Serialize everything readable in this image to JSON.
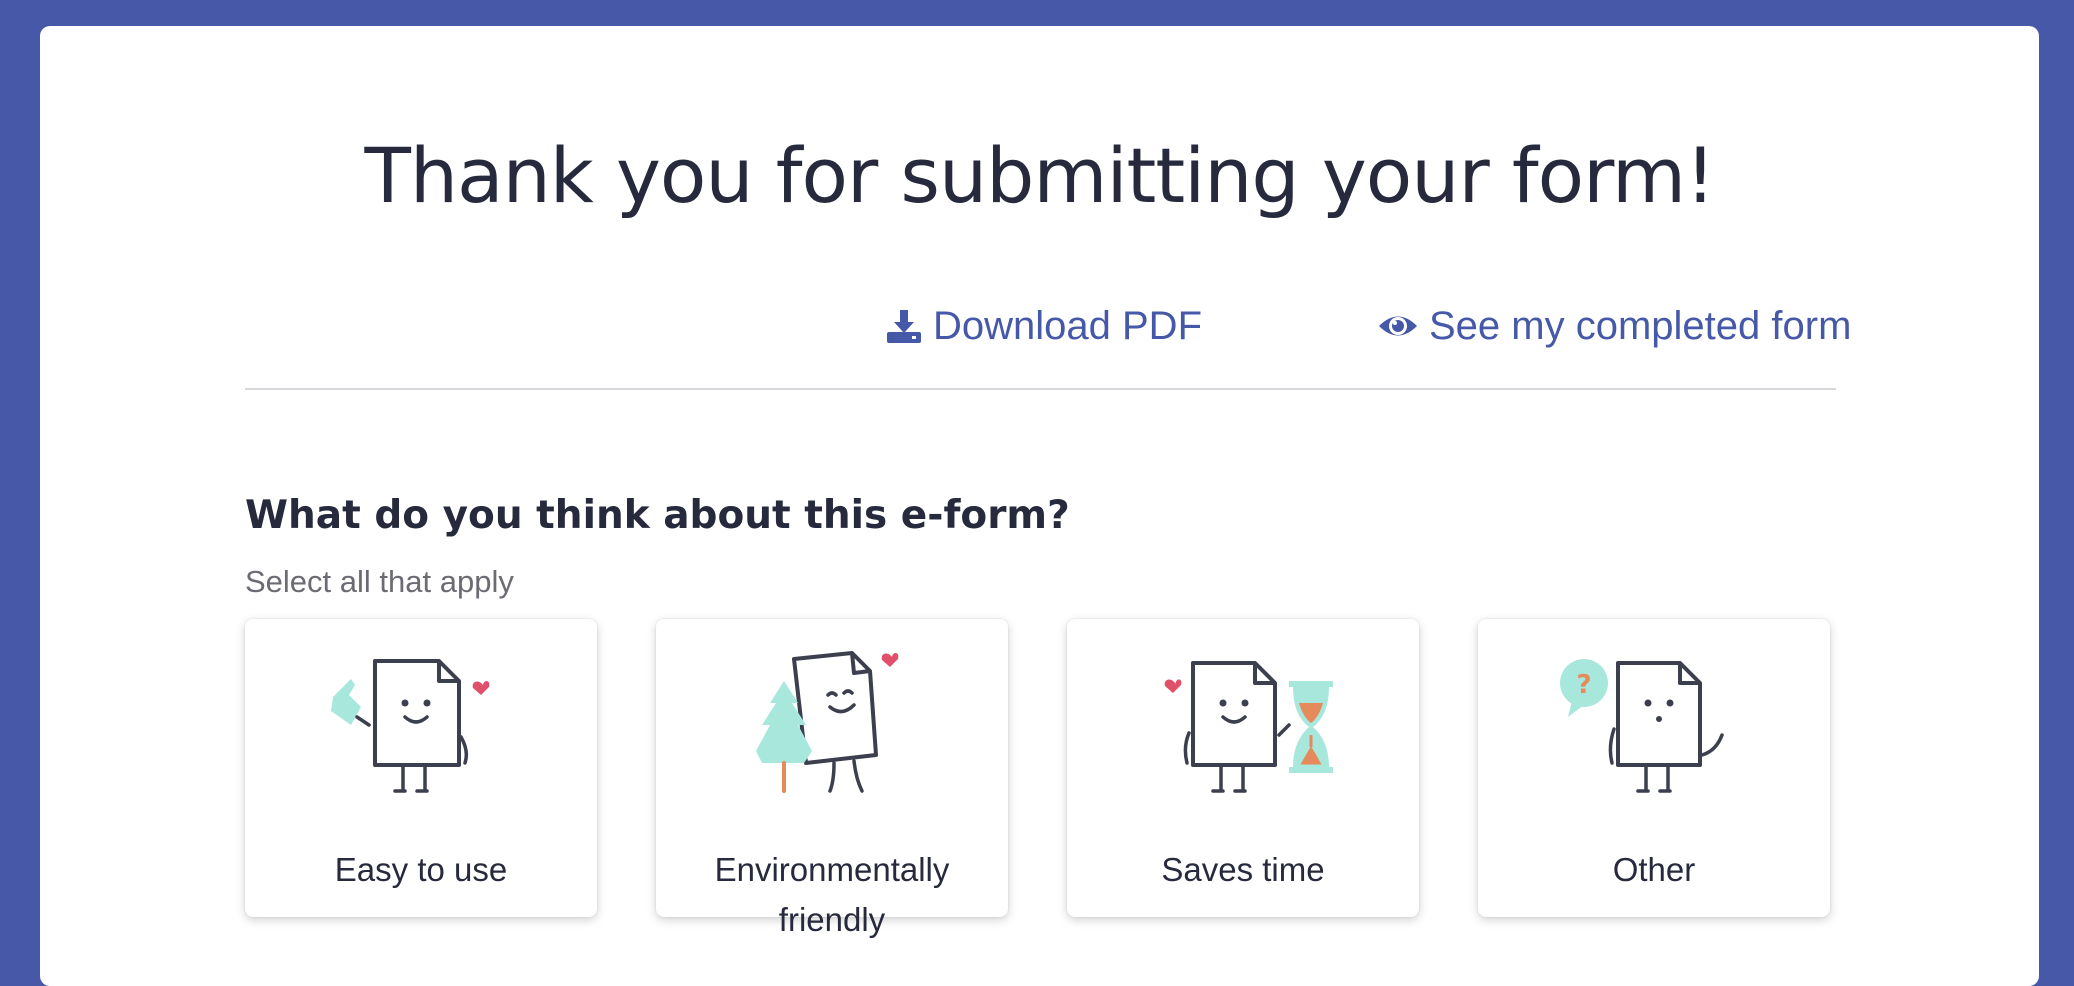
{
  "heading": "Thank you for submitting your form!",
  "actions": {
    "download_label": "Download PDF",
    "view_label": "See my completed form"
  },
  "feedback": {
    "question": "What do you think about this e-form?",
    "hint": "Select all that apply",
    "options": [
      {
        "label": "Easy to use",
        "icon": "pointing-hand-document-icon"
      },
      {
        "label": "Environmentally friendly",
        "icon": "tree-hug-document-icon"
      },
      {
        "label": "Saves time",
        "icon": "hourglass-document-icon"
      },
      {
        "label": "Other",
        "icon": "question-bubble-document-icon"
      }
    ]
  },
  "colors": {
    "background": "#4858a8",
    "link": "#4659a8",
    "mint": "#a8e8dc",
    "heart": "#e0506a",
    "orange": "#e58a5a"
  }
}
